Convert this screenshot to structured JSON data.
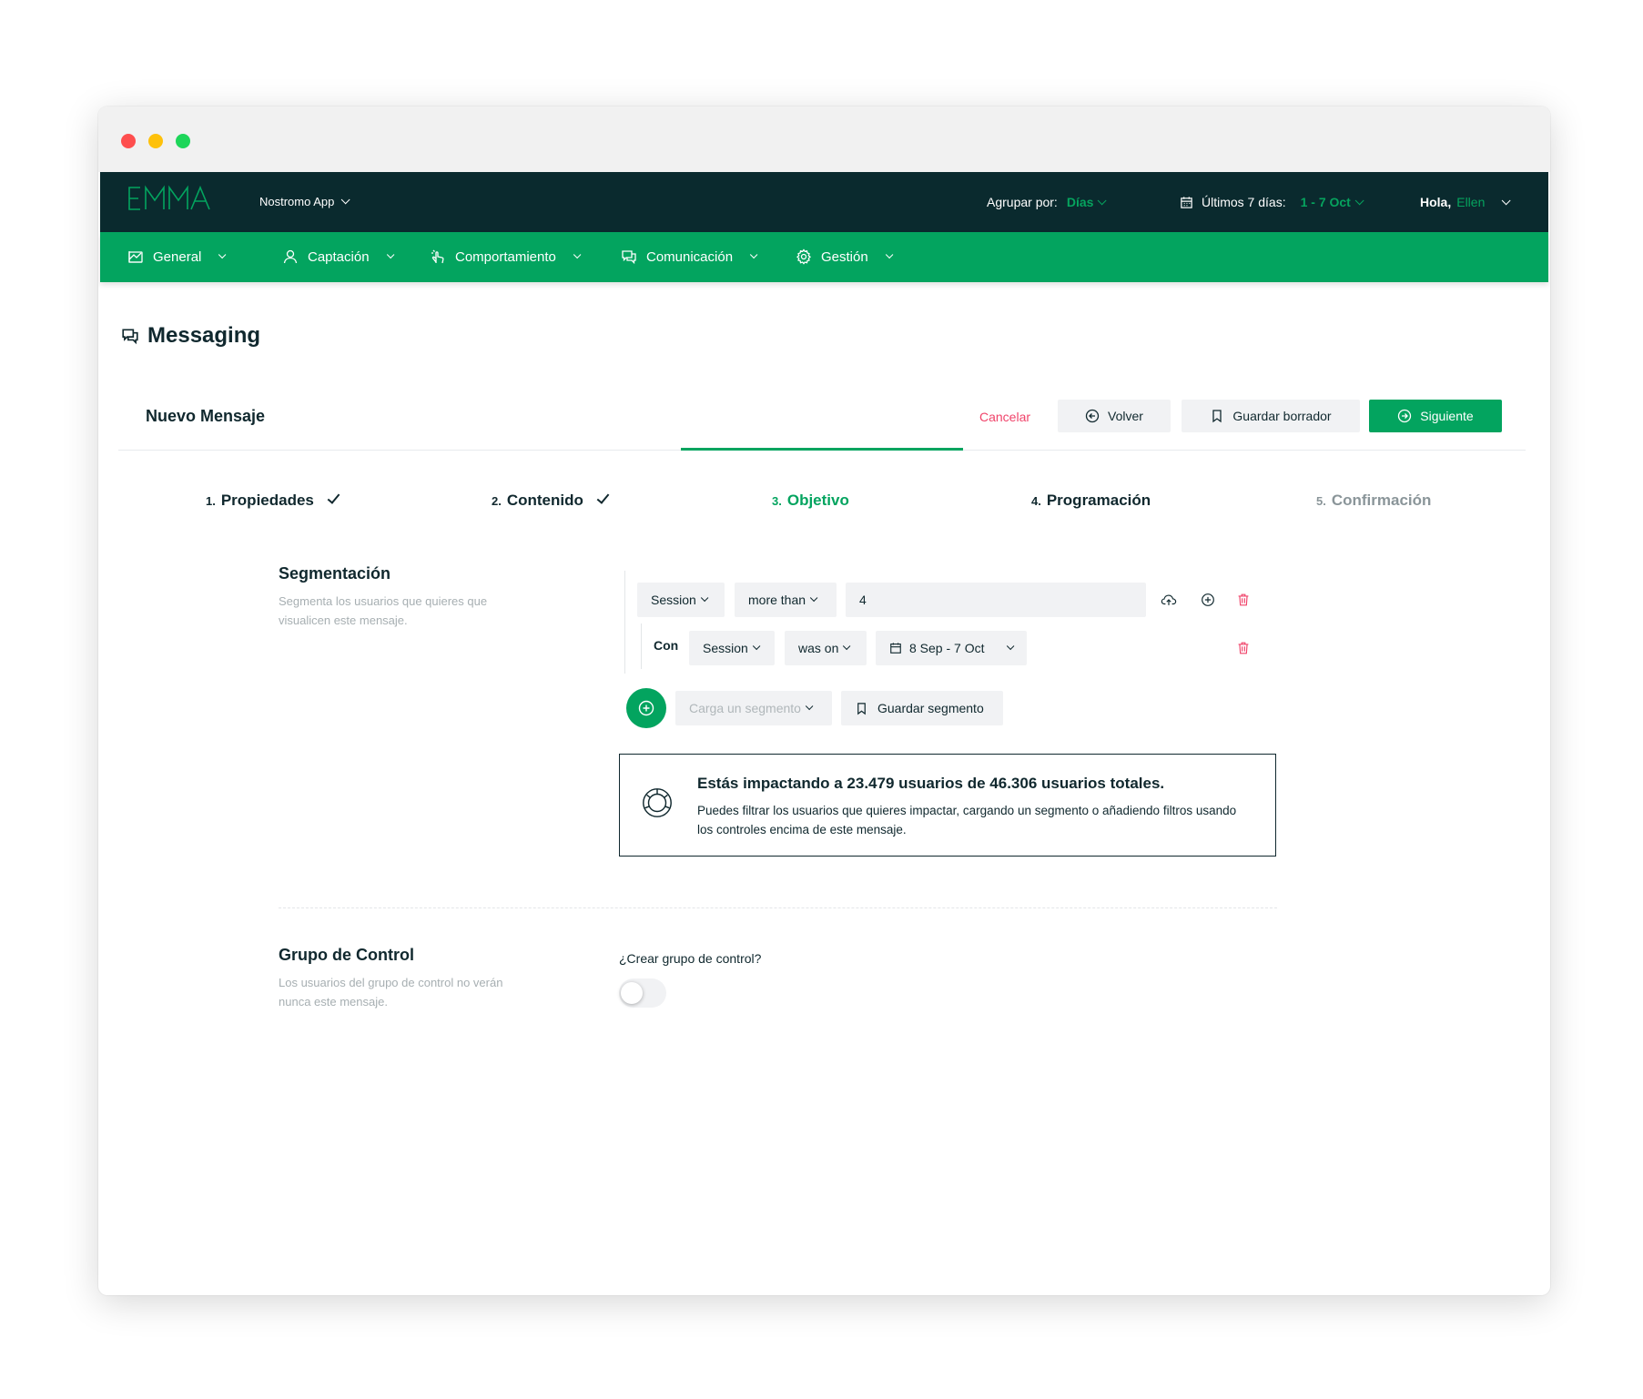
{
  "colors": {
    "brand_green": "#03a45f",
    "topbar_bg": "#0a2a2e",
    "danger": "#f0436a",
    "text_dark": "#10282e",
    "text_muted": "#a7afb2"
  },
  "topbar": {
    "logo_text": "EMMA",
    "app_name": "Nostromo App",
    "group_label": "Agrupar por:",
    "group_value": "Días",
    "period_label": "Últimos 7 días:",
    "period_value": "1 - 7 Oct",
    "greeting": "Hola,",
    "user_name": "Ellen"
  },
  "nav": [
    {
      "label": "General",
      "icon": "chart-icon"
    },
    {
      "label": "Captación",
      "icon": "user-icon"
    },
    {
      "label": "Comportamiento",
      "icon": "pointer-icon"
    },
    {
      "label": "Comunicación",
      "icon": "chat-icon"
    },
    {
      "label": "Gestión",
      "icon": "gear-icon"
    }
  ],
  "page": {
    "title": "Messaging",
    "icon": "chat-icon"
  },
  "message": {
    "header": "Nuevo Mensaje",
    "cancel": "Cancelar",
    "back": "Volver",
    "save_draft": "Guardar borrador",
    "next": "Siguiente"
  },
  "steps": [
    {
      "num": "1.",
      "label": "Propiedades",
      "state": "done"
    },
    {
      "num": "2.",
      "label": "Contenido",
      "state": "done"
    },
    {
      "num": "3.",
      "label": "Objetivo",
      "state": "active"
    },
    {
      "num": "4.",
      "label": "Programación",
      "state": "pending"
    },
    {
      "num": "5.",
      "label": "Confirmación",
      "state": "disabled"
    }
  ],
  "segmentation": {
    "title": "Segmentación",
    "description": "Segmenta los usuarios que quieres que visualicen este mensaje.",
    "rule": {
      "field": "Session",
      "operator": "more than",
      "value": "4"
    },
    "sub_rule": {
      "label": "Con",
      "field": "Session",
      "operator": "was on",
      "date_range": "8 Sep - 7 Oct"
    },
    "load_segment_placeholder": "Carga un segmento",
    "save_segment": "Guardar segmento"
  },
  "impact": {
    "prefix": "Estás impactando a",
    "impacted": "23.479",
    "middle": "usuarios de",
    "total": "46.306",
    "suffix": "usuarios totales.",
    "description": "Puedes filtrar los usuarios que quieres impactar, cargando un segmento o añadiendo filtros usando los controles encima de este mensaje."
  },
  "control_group": {
    "title": "Grupo de Control",
    "description": "Los usuarios del grupo de control no verán nunca este mensaje.",
    "question": "¿Crear grupo de control?",
    "enabled": false
  }
}
